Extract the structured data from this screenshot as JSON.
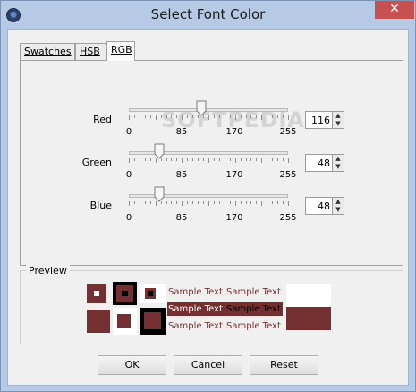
{
  "window": {
    "title": "Select Font Color",
    "close_label": "✕"
  },
  "tabs": [
    {
      "label": "Swatches",
      "active": false
    },
    {
      "label": "HSB",
      "active": false
    },
    {
      "label": "RGB",
      "active": true
    }
  ],
  "sliders": [
    {
      "label": "Red",
      "value": 116,
      "min": 0,
      "max": 255
    },
    {
      "label": "Green",
      "value": 48,
      "min": 0,
      "max": 255
    },
    {
      "label": "Blue",
      "value": 48,
      "min": 0,
      "max": 255
    }
  ],
  "tick_labels": [
    "0",
    "85",
    "170",
    "255"
  ],
  "watermark": "SOFTPEDIA",
  "preview": {
    "legend": "Preview",
    "sample_text": "Sample Text",
    "color": "#743030"
  },
  "buttons": {
    "ok": "OK",
    "cancel": "Cancel",
    "reset": "Reset"
  },
  "colors": {
    "title_bar": "#b6cae6",
    "close_button": "#c75050",
    "dialog_background": "#f0f0f0"
  }
}
